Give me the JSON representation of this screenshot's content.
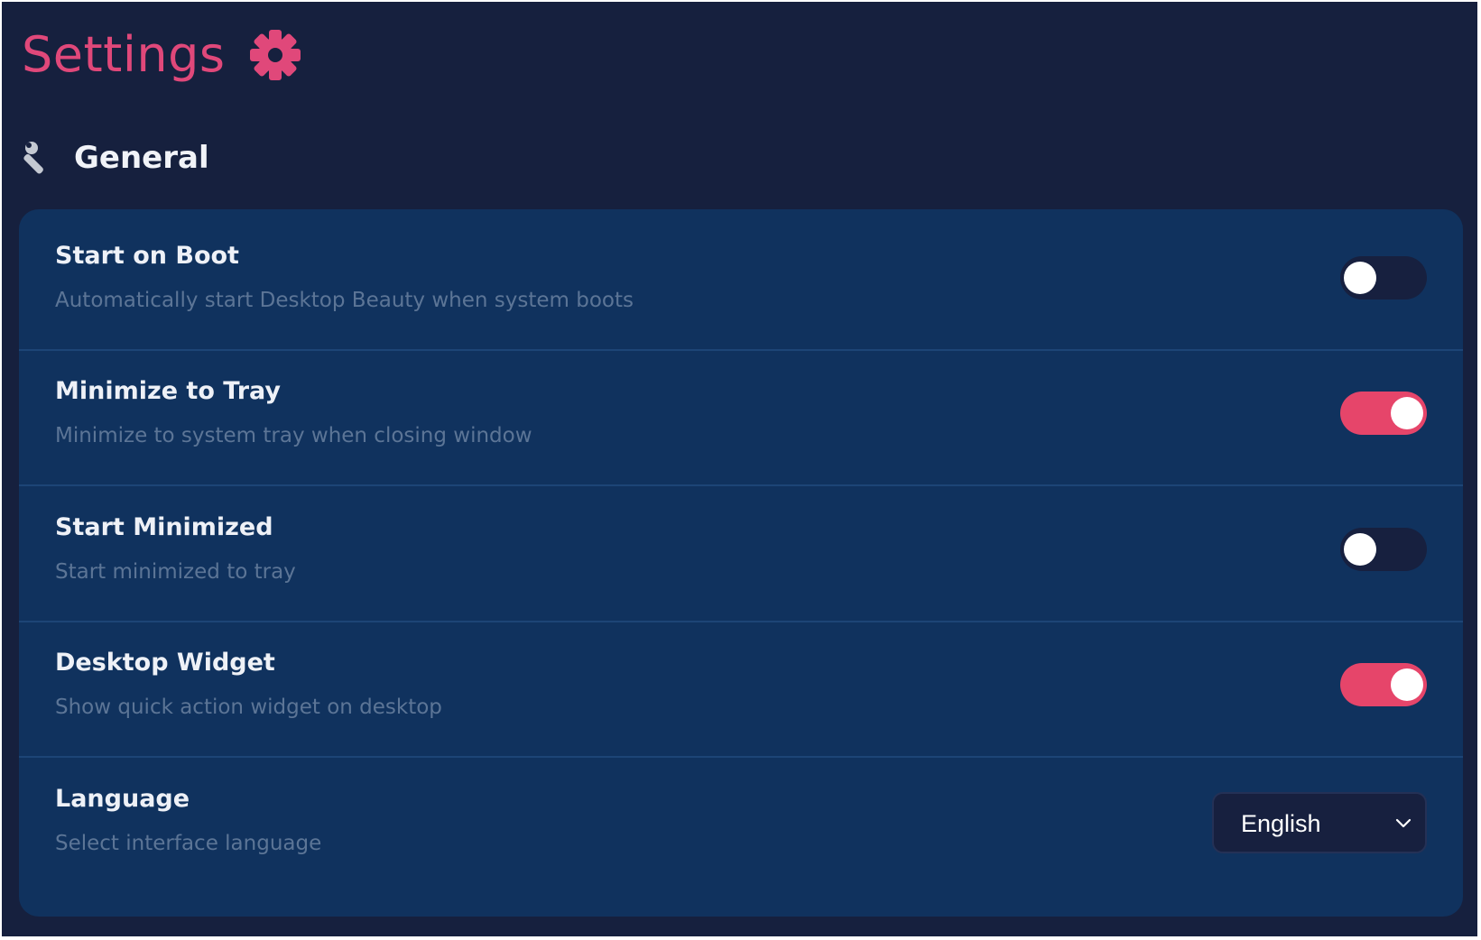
{
  "header": {
    "title": "Settings",
    "icon": "gear-icon",
    "accent_color": "#e0487a"
  },
  "section": {
    "title": "General",
    "icon": "wrench-icon"
  },
  "settings": [
    {
      "label": "Start on Boot",
      "description": "Automatically start Desktop Beauty when system boots",
      "type": "toggle",
      "enabled": false
    },
    {
      "label": "Minimize to Tray",
      "description": "Minimize to system tray when closing window",
      "type": "toggle",
      "enabled": true
    },
    {
      "label": "Start Minimized",
      "description": "Start minimized to tray",
      "type": "toggle",
      "enabled": false
    },
    {
      "label": "Desktop Widget",
      "description": "Show quick action widget on desktop",
      "type": "toggle",
      "enabled": true
    },
    {
      "label": "Language",
      "description": "Select interface language",
      "type": "select",
      "value": "English"
    }
  ],
  "colors": {
    "background": "#16203e",
    "card": "#10325e",
    "toggle_on": "#e6456a",
    "toggle_off": "#17203f"
  }
}
